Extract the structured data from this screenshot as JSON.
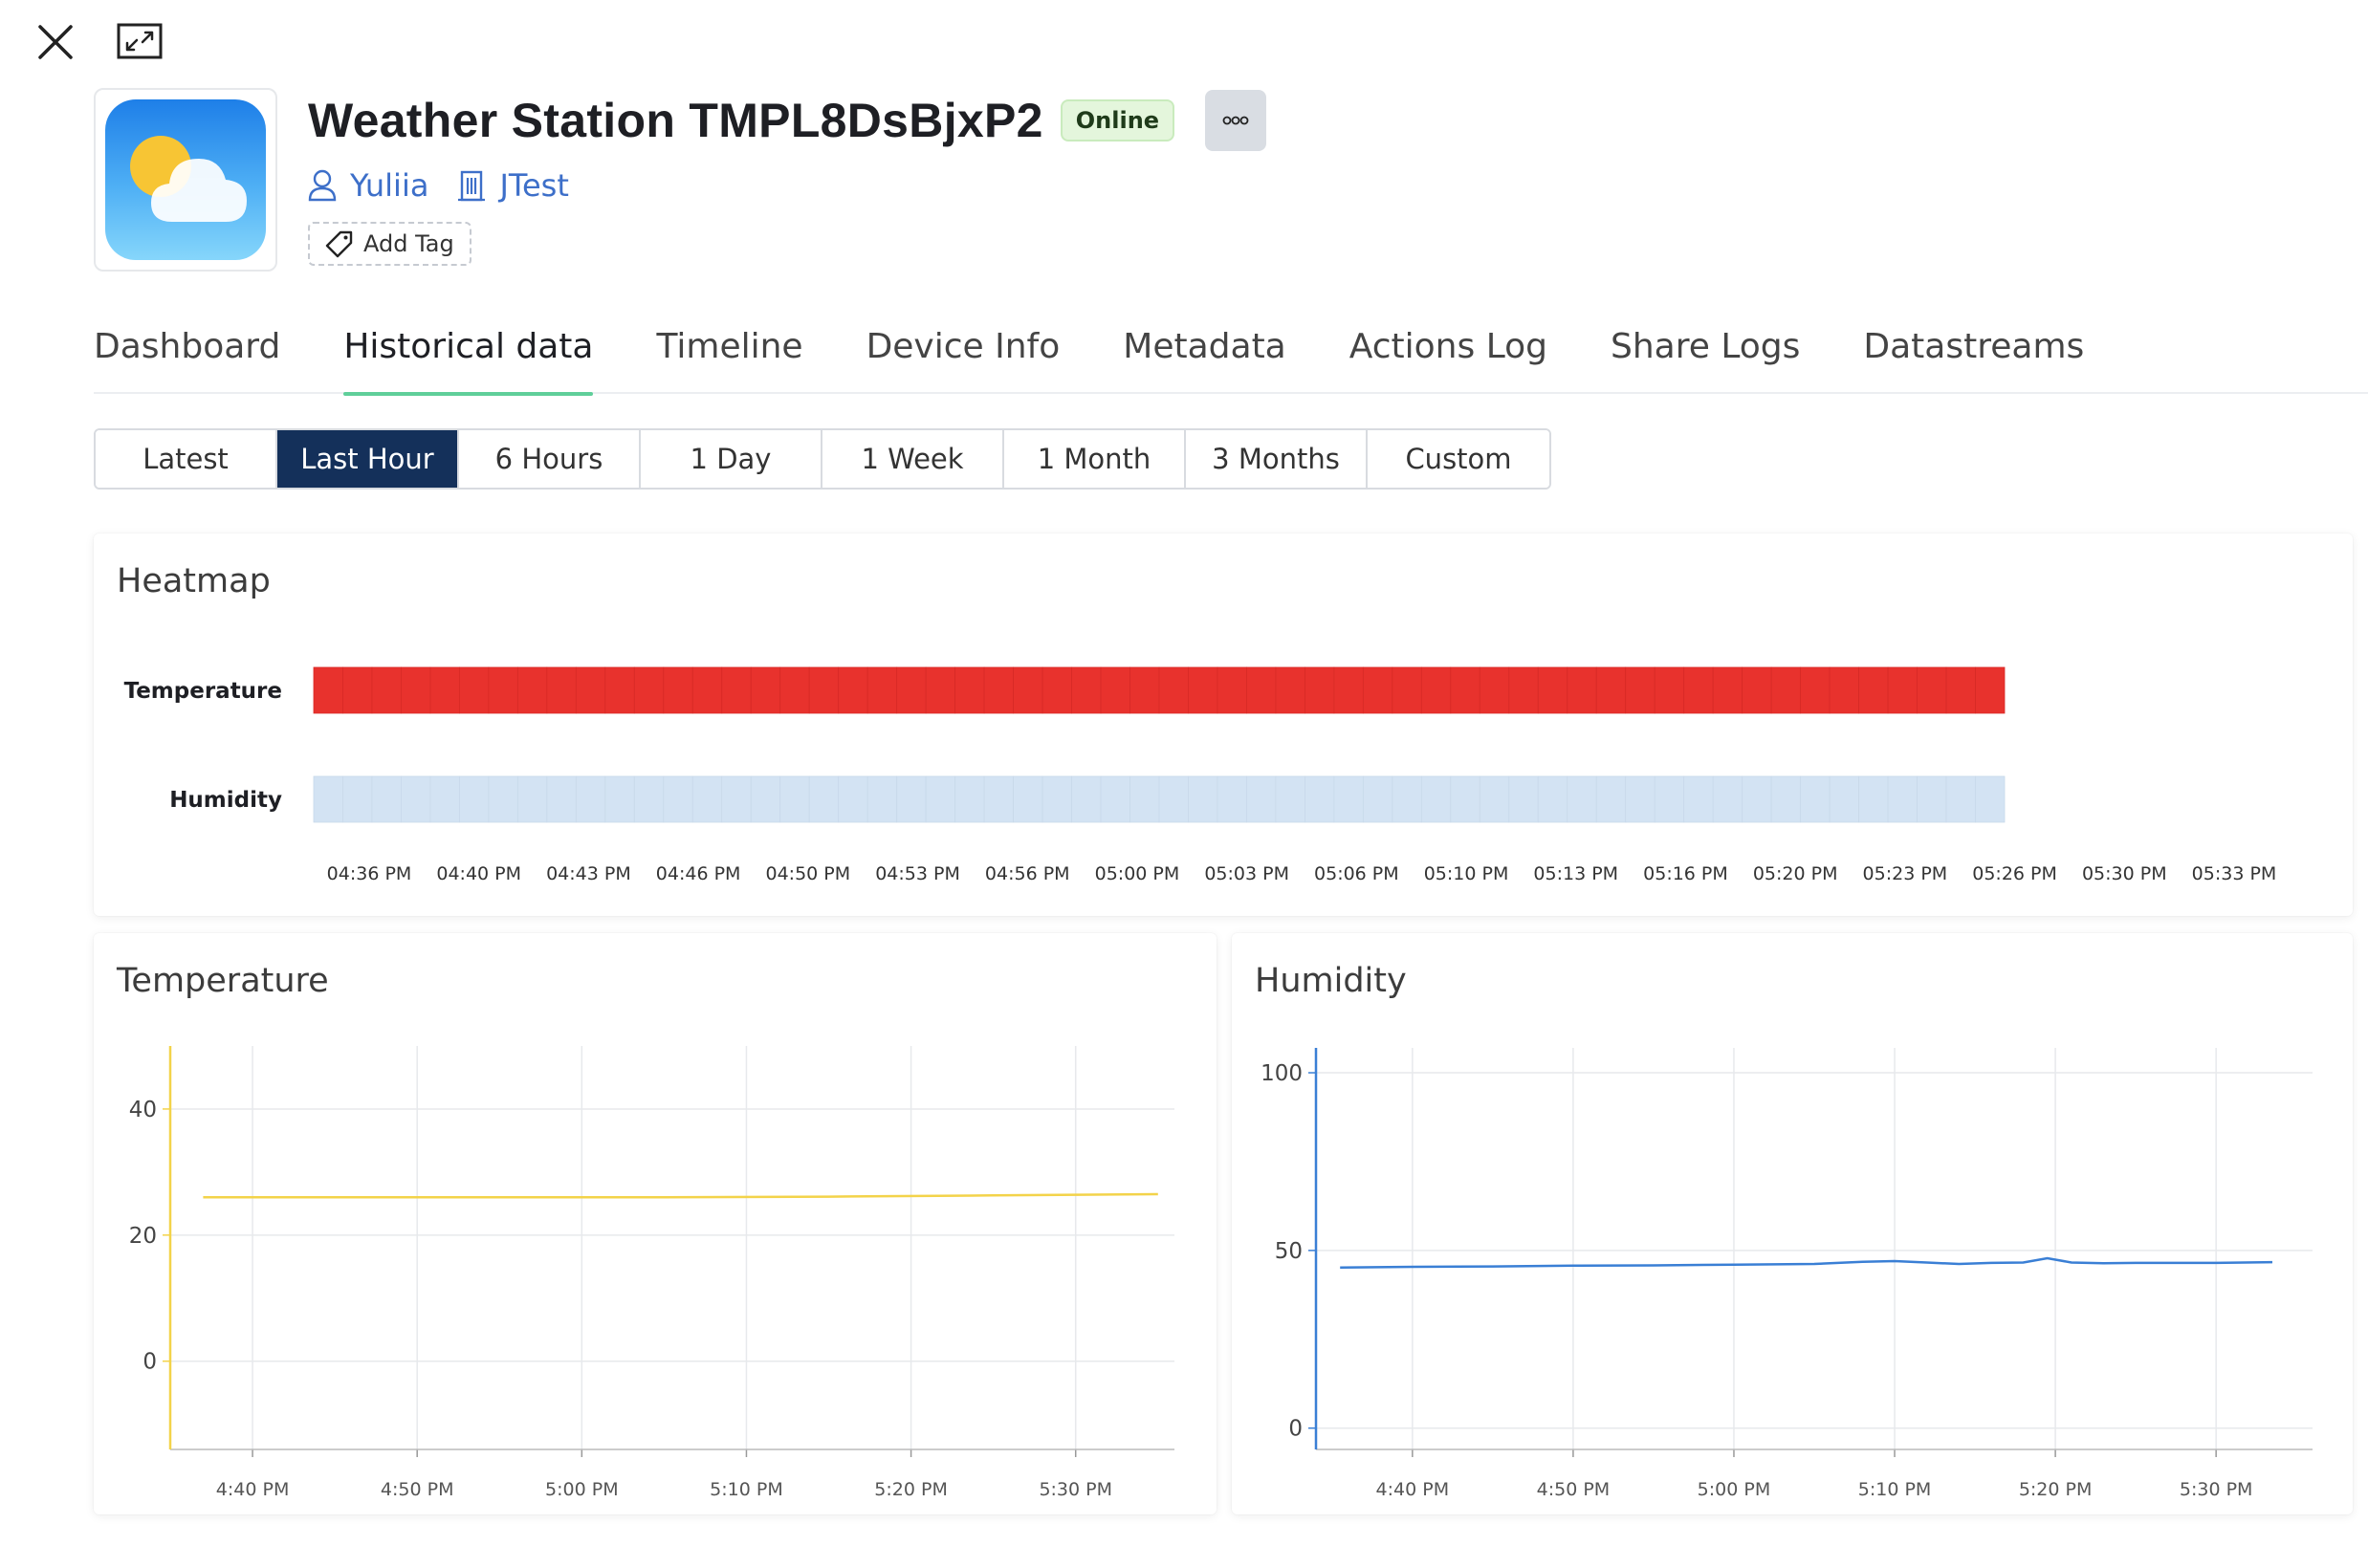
{
  "device": {
    "title": "Weather Station TMPL8DsBjxP2",
    "status": "Online",
    "owner": "Yuliia",
    "organization": "JTest",
    "add_tag_label": "Add Tag",
    "icon": "weather-cloud-sun-icon"
  },
  "tabs": [
    "Dashboard",
    "Historical data",
    "Timeline",
    "Device Info",
    "Metadata",
    "Actions Log",
    "Share Logs",
    "Datastreams"
  ],
  "active_tab": "Historical data",
  "time_ranges": [
    "Latest",
    "Last Hour",
    "6 Hours",
    "1 Day",
    "1 Week",
    "1 Month",
    "3 Months",
    "Custom"
  ],
  "active_range": "Last Hour",
  "colors": {
    "accent_tab": "#5fcf9a",
    "active_range_bg": "#14305a",
    "heat_temperature": "#e8322d",
    "heat_humidity": "#d3e3f3",
    "temp_line": "#f3d34a",
    "hum_line": "#3a7fd5",
    "status_bg": "#e4f6dc"
  },
  "heatmap": {
    "title": "Heatmap",
    "rows": [
      "Temperature",
      "Humidity"
    ],
    "cells": 58,
    "time_labels": [
      "04:36 PM",
      "04:40 PM",
      "04:43 PM",
      "04:46 PM",
      "04:50 PM",
      "04:53 PM",
      "04:56 PM",
      "05:00 PM",
      "05:03 PM",
      "05:06 PM",
      "05:10 PM",
      "05:13 PM",
      "05:16 PM",
      "05:20 PM",
      "05:23 PM",
      "05:26 PM",
      "05:30 PM",
      "05:33 PM"
    ]
  },
  "chart_data": [
    {
      "type": "line",
      "title": "Temperature",
      "x_start_minutes": 15,
      "x_end_minutes": 76,
      "xticks": [
        {
          "min": 20,
          "label": "4:40 PM"
        },
        {
          "min": 30,
          "label": "4:50 PM"
        },
        {
          "min": 40,
          "label": "5:00 PM"
        },
        {
          "min": 50,
          "label": "5:10 PM"
        },
        {
          "min": 60,
          "label": "5:20 PM"
        },
        {
          "min": 70,
          "label": "5:30 PM"
        }
      ],
      "yticks": [
        0,
        20,
        40
      ],
      "ylim": [
        -14,
        50
      ],
      "series": [
        {
          "name": "Temperature",
          "x": [
            17,
            25,
            35,
            45,
            55,
            65,
            75
          ],
          "values": [
            26.0,
            26.0,
            26.0,
            26.0,
            26.1,
            26.3,
            26.5
          ]
        }
      ]
    },
    {
      "type": "line",
      "title": "Humidity",
      "x_start_minutes": 14,
      "x_end_minutes": 76,
      "xticks": [
        {
          "min": 20,
          "label": "4:40 PM"
        },
        {
          "min": 30,
          "label": "4:50 PM"
        },
        {
          "min": 40,
          "label": "5:00 PM"
        },
        {
          "min": 50,
          "label": "5:10 PM"
        },
        {
          "min": 60,
          "label": "5:20 PM"
        },
        {
          "min": 70,
          "label": "5:30 PM"
        }
      ],
      "yticks": [
        0,
        50,
        100
      ],
      "ylim": [
        -6,
        107
      ],
      "series": [
        {
          "name": "Humidity",
          "x": [
            15.5,
            20,
            25,
            30,
            35,
            40,
            45,
            48,
            50,
            52,
            54,
            56,
            58,
            59.5,
            61,
            63,
            65,
            70,
            73.5
          ],
          "values": [
            45.2,
            45.4,
            45.5,
            45.7,
            45.8,
            46.0,
            46.2,
            46.8,
            47.0,
            46.6,
            46.2,
            46.5,
            46.6,
            47.8,
            46.6,
            46.4,
            46.5,
            46.5,
            46.7
          ]
        }
      ]
    }
  ]
}
